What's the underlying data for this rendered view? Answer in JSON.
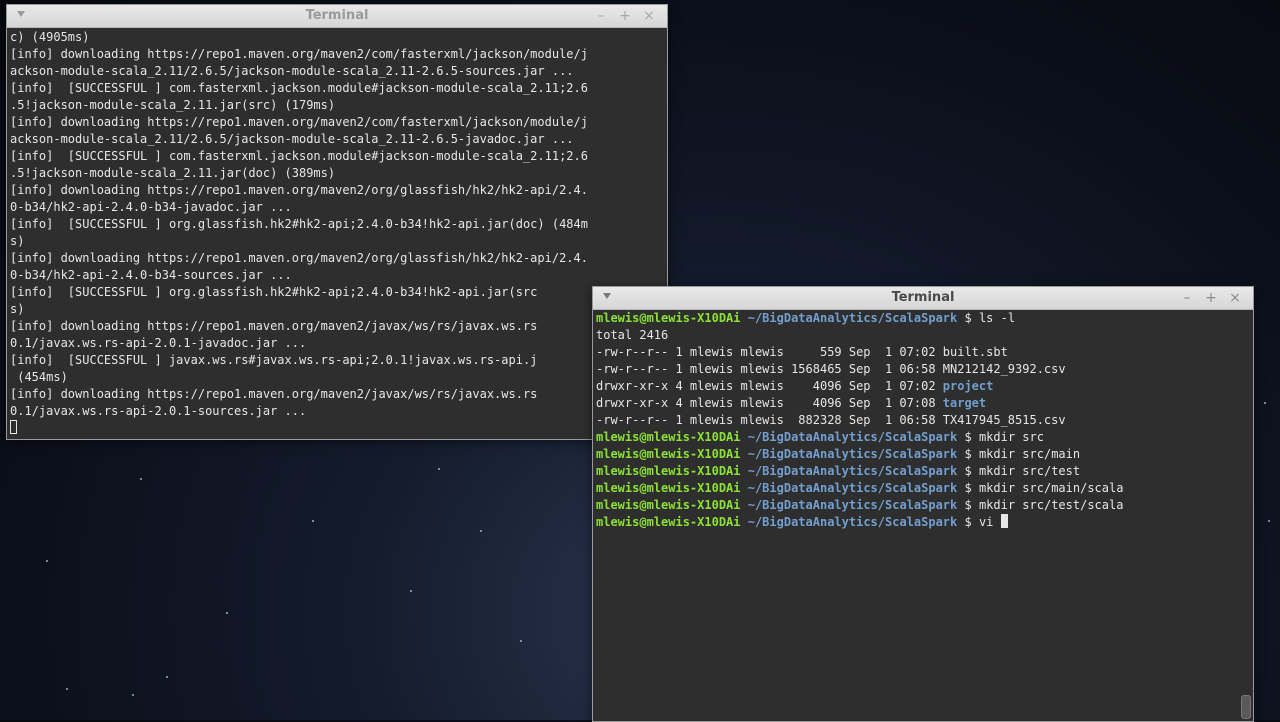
{
  "windows": {
    "back": {
      "title": "Terminal",
      "lines": [
        "c) (4905ms)",
        "[info] downloading https://repo1.maven.org/maven2/com/fasterxml/jackson/module/j",
        "ackson-module-scala_2.11/2.6.5/jackson-module-scala_2.11-2.6.5-sources.jar ...",
        "[info]  [SUCCESSFUL ] com.fasterxml.jackson.module#jackson-module-scala_2.11;2.6",
        ".5!jackson-module-scala_2.11.jar(src) (179ms)",
        "[info] downloading https://repo1.maven.org/maven2/com/fasterxml/jackson/module/j",
        "ackson-module-scala_2.11/2.6.5/jackson-module-scala_2.11-2.6.5-javadoc.jar ...",
        "[info]  [SUCCESSFUL ] com.fasterxml.jackson.module#jackson-module-scala_2.11;2.6",
        ".5!jackson-module-scala_2.11.jar(doc) (389ms)",
        "[info] downloading https://repo1.maven.org/maven2/org/glassfish/hk2/hk2-api/2.4.",
        "0-b34/hk2-api-2.4.0-b34-javadoc.jar ...",
        "[info]  [SUCCESSFUL ] org.glassfish.hk2#hk2-api;2.4.0-b34!hk2-api.jar(doc) (484m",
        "s)",
        "[info] downloading https://repo1.maven.org/maven2/org/glassfish/hk2/hk2-api/2.4.",
        "0-b34/hk2-api-2.4.0-b34-sources.jar ...",
        "[info]  [SUCCESSFUL ] org.glassfish.hk2#hk2-api;2.4.0-b34!hk2-api.jar(src",
        "s)",
        "[info] downloading https://repo1.maven.org/maven2/javax/ws/rs/javax.ws.rs",
        "0.1/javax.ws.rs-api-2.0.1-javadoc.jar ...",
        "[info]  [SUCCESSFUL ] javax.ws.rs#javax.ws.rs-api;2.0.1!javax.ws.rs-api.j",
        " (454ms)",
        "[info] downloading https://repo1.maven.org/maven2/javax/ws/rs/javax.ws.rs",
        "0.1/javax.ws.rs-api-2.0.1-sources.jar ..."
      ]
    },
    "front": {
      "title": "Terminal",
      "prompt_user": "mlewis@mlewis-X10DAi",
      "prompt_path": "~/BigDataAnalytics/ScalaSpark",
      "prompt_symbol": "$",
      "commands": {
        "ls": "ls -l",
        "mkdir1": "mkdir src",
        "mkdir2": "mkdir src/main",
        "mkdir3": "mkdir src/test",
        "mkdir4": "mkdir src/main/scala",
        "mkdir5": "mkdir src/test/scala",
        "current": "vi "
      },
      "ls_total": "total 2416",
      "ls_entries": [
        {
          "meta": "-rw-r--r-- 1 mlewis mlewis     559 Sep  1 07:02 ",
          "name": "built.sbt"
        },
        {
          "meta": "-rw-r--r-- 1 mlewis mlewis 1568465 Sep  1 06:58 ",
          "name": "MN212142_9392.csv"
        },
        {
          "meta": "drwxr-xr-x 4 mlewis mlewis    4096 Sep  1 07:02 ",
          "name": "project"
        },
        {
          "meta": "drwxr-xr-x 4 mlewis mlewis    4096 Sep  1 07:08 ",
          "name": "target"
        },
        {
          "meta": "-rw-r--r-- 1 mlewis mlewis  882328 Sep  1 06:58 ",
          "name": "TX417945_8515.csv"
        }
      ]
    },
    "controls": {
      "minimize": "–",
      "maximize": "+",
      "close": "×"
    }
  },
  "icons": [
    "menu-arrow-icon",
    "minimize-icon",
    "maximize-icon",
    "close-icon"
  ]
}
